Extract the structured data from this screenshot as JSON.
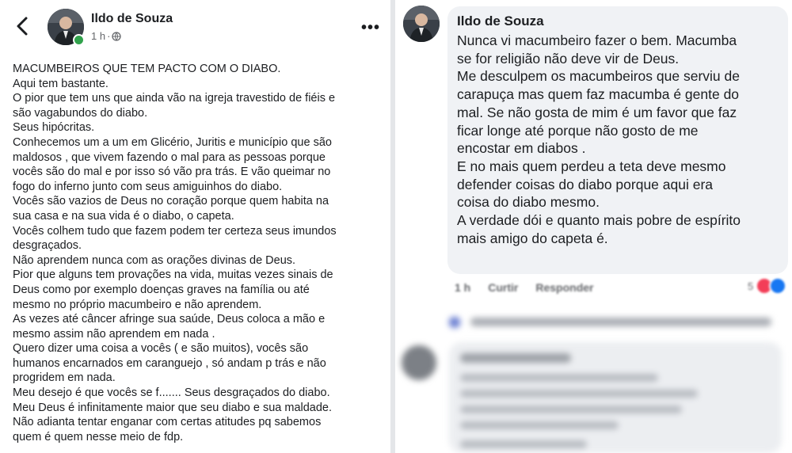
{
  "left": {
    "author": "Ildo de Souza",
    "time": "1 h",
    "dot": "·",
    "post_lines": [
      "MACUMBEIROS QUE TEM PACTO COM O DIABO.",
      "Aqui tem bastante.",
      "O pior que tem uns que ainda vão na igreja travestido de fiéis e",
      "são vagabundos do diabo.",
      "Seus hipócritas.",
      "Conhecemos um a um em Glicério, Juritis e município que são",
      "maldosos , que vivem fazendo o mal para as pessoas porque",
      "vocês são do mal e por isso só vão pra trás. E vão queimar no",
      "fogo do inferno junto com seus amiguinhos do diabo.",
      "Vocês são vazios de Deus no coração porque quem habita na",
      "sua casa e na sua vida é o diabo, o capeta.",
      "Vocês colhem tudo que fazem podem ter certeza seus imundos",
      "desgraçados.",
      "Não aprendem nunca com as orações divinas de Deus.",
      "Pior que alguns tem provações na vida,  muitas vezes sinais de",
      "Deus como por exemplo doenças graves na família ou até",
      "mesmo no próprio macumbeiro e não aprendem.",
      "As vezes até câncer afringe sua saúde, Deus coloca a mão e",
      "mesmo assim não aprendem em nada .",
      "Quero dizer uma coisa a vocês ( e são muitos), vocês são",
      "humanos encarnados em caranguejo , só andam p trás e não",
      "progridem em nada.",
      "Meu desejo é que vocês se f....... Seus desgraçados do diabo.",
      "Meu Deus é infinitamente maior que seu diabo e sua maldade.",
      "Não adianta tentar enganar com  certas atitudes pq sabemos",
      "quem é quem nesse meio de fdp."
    ]
  },
  "right": {
    "author": "Ildo de Souza",
    "comment_lines": [
      "Nunca vi macumbeiro fazer o bem. Macumba",
      "se for religião não deve vir de Deus.",
      "Me desculpem os macumbeiros que serviu de",
      "carapuça mas quem faz macumba é gente do",
      "mal. Se não gosta de mim é um favor que faz",
      "ficar longe até porque não gosto de me",
      "encostar em diabos .",
      "E no mais quem perdeu a teta deve mesmo",
      "defender coisas do diabo porque aqui era",
      "coisa do diabo mesmo.",
      "A verdade dói e quanto mais pobre de espírito",
      "mais amigo do capeta é."
    ],
    "actions": {
      "time": "1 h",
      "like": "Curtir",
      "reply": "Responder"
    },
    "reaction_count": "5",
    "colors": {
      "love": "#f33e58",
      "like": "#1877f2",
      "bubble": "#f0f2f5"
    }
  }
}
